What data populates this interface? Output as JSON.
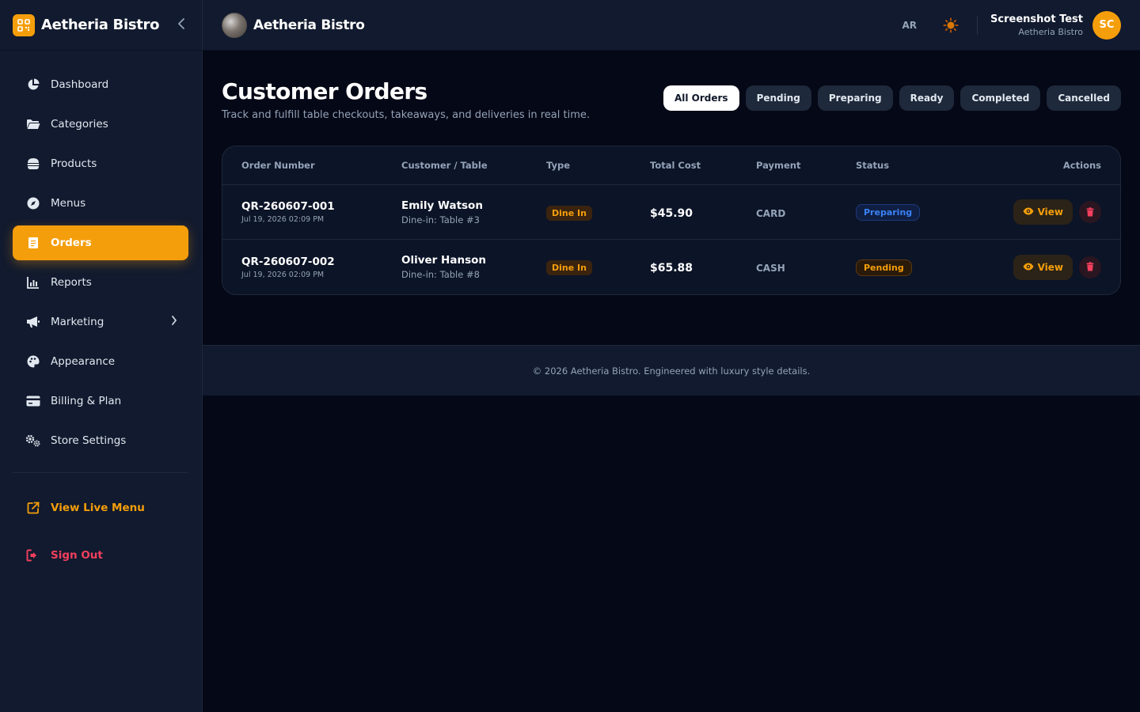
{
  "app": {
    "name": "Aetheria Bistro"
  },
  "sidebar": {
    "items": [
      {
        "label": "Dashboard",
        "icon": "pie-chart-icon"
      },
      {
        "label": "Categories",
        "icon": "folder-icon"
      },
      {
        "label": "Products",
        "icon": "burger-icon"
      },
      {
        "label": "Menus",
        "icon": "compass-icon"
      },
      {
        "label": "Orders",
        "icon": "receipt-icon",
        "active": true
      },
      {
        "label": "Reports",
        "icon": "bar-chart-icon"
      },
      {
        "label": "Marketing",
        "icon": "megaphone-icon"
      },
      {
        "label": "Appearance",
        "icon": "palette-icon"
      },
      {
        "label": "Billing & Plan",
        "icon": "credit-card-icon"
      },
      {
        "label": "Store Settings",
        "icon": "gears-icon"
      }
    ],
    "view_live_menu": "View Live Menu",
    "sign_out": "Sign Out"
  },
  "header": {
    "store_name": "Aetheria Bistro",
    "lang": "AR",
    "user_name": "Screenshot Test",
    "user_store": "Aetheria Bistro",
    "user_initials": "SC"
  },
  "page": {
    "title": "Customer Orders",
    "subtitle": "Track and fulfill table checkouts, takeaways, and deliveries in real time."
  },
  "filters": [
    "All Orders",
    "Pending",
    "Preparing",
    "Ready",
    "Completed",
    "Cancelled"
  ],
  "table": {
    "headers": {
      "order_number": "Order Number",
      "customer": "Customer / Table",
      "type": "Type",
      "total": "Total Cost",
      "payment": "Payment",
      "status": "Status",
      "actions": "Actions"
    },
    "view_label": "View",
    "rows": [
      {
        "order_number": "QR-260607-001",
        "date": "Jul 19, 2026 02:09 PM",
        "customer": "Emily Watson",
        "table": "Dine-in: Table #3",
        "type": "Dine In",
        "total": "$45.90",
        "payment": "CARD",
        "status": "Preparing"
      },
      {
        "order_number": "QR-260607-002",
        "date": "Jul 19, 2026 02:09 PM",
        "customer": "Oliver Hanson",
        "table": "Dine-in: Table #8",
        "type": "Dine In",
        "total": "$65.88",
        "payment": "CASH",
        "status": "Pending"
      }
    ]
  },
  "footer": {
    "text": "© 2026 Aetheria Bistro. Engineered with luxury style details."
  },
  "colors": {
    "accent": "#f59e0b",
    "danger": "#f43f5e",
    "info": "#3b82f6",
    "bg": "#050816",
    "panel": "#111a2e"
  }
}
